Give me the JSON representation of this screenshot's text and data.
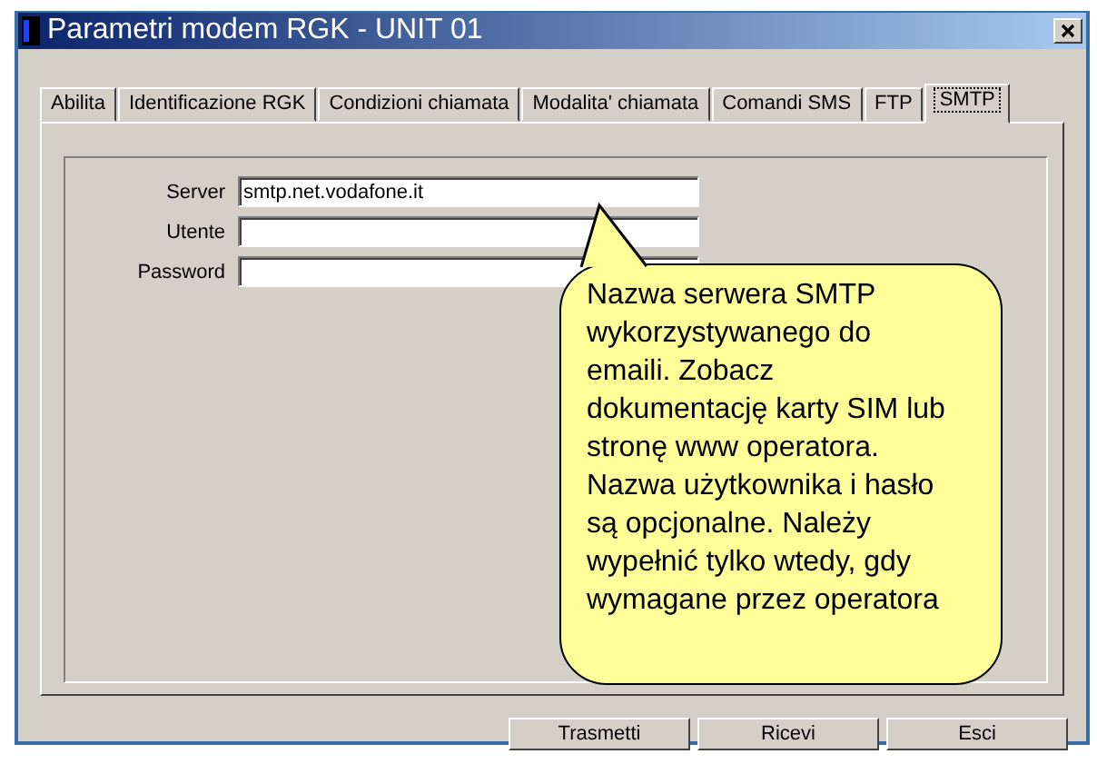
{
  "window": {
    "title": "Parametri modem RGK - UNIT 01"
  },
  "tabs": [
    {
      "label": "Abilita",
      "selected": false
    },
    {
      "label": "Identificazione RGK",
      "selected": false
    },
    {
      "label": "Condizioni chiamata",
      "selected": false
    },
    {
      "label": "Modalita' chiamata",
      "selected": false
    },
    {
      "label": "Comandi SMS",
      "selected": false
    },
    {
      "label": "FTP",
      "selected": false
    },
    {
      "label": "SMTP",
      "selected": true
    }
  ],
  "fields": [
    {
      "label": "Server",
      "value": "smtp.net.vodafone.it"
    },
    {
      "label": "Utente"
    },
    {
      "label": "Password"
    }
  ],
  "callout": {
    "text": "Nazwa serwera SMTP wykorzystywanego do emaili. Zobacz dokumentację karty SIM lub stronę www operatora. Nazwa użytkownika i hasło są opcjonalne. Należy wypełnić tylko wtedy, gdy wymagane przez operatora"
  },
  "buttons": [
    "Trasmetti",
    "Ricevi",
    "Esci"
  ]
}
